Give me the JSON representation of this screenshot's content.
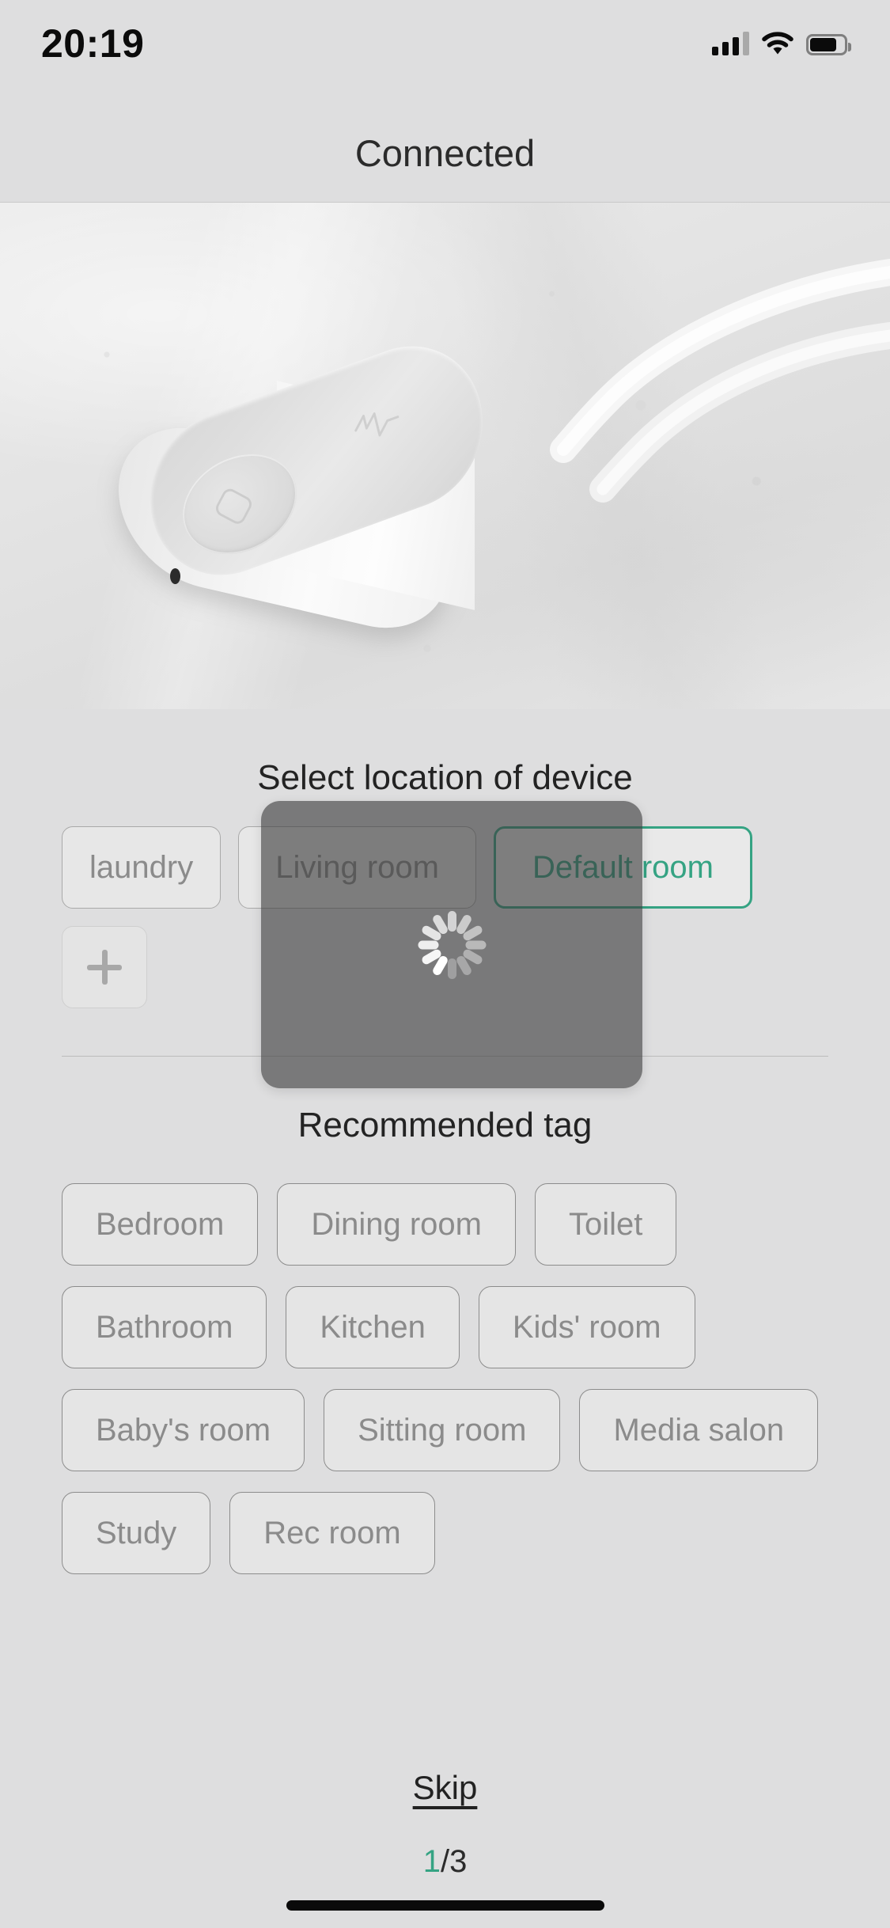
{
  "status_bar": {
    "time": "20:19",
    "cellular_icon": "cellular-signal-icon",
    "cellular_bars_filled": 3,
    "cellular_bars_total": 4,
    "wifi_icon": "wifi-icon",
    "battery_icon": "battery-icon",
    "battery_level_percent": 72
  },
  "nav": {
    "title": "Connected"
  },
  "hero": {
    "alt": "white smart relay device with two cables on a light textured wall"
  },
  "location_section": {
    "title": "Select location of device",
    "rooms": [
      {
        "label": "laundry",
        "selected": false
      },
      {
        "label": "Living room",
        "selected": false
      },
      {
        "label": "Default room",
        "selected": true
      }
    ],
    "add_room_icon": "plus-icon",
    "loading": true,
    "spinner_icon": "activity-spinner-icon"
  },
  "recommended_section": {
    "title": "Recommended tag",
    "tags": [
      "Bedroom",
      "Dining room",
      "Toilet",
      "Bathroom",
      "Kitchen",
      "Kids' room",
      "Baby's room",
      "Sitting room",
      "Media salon",
      "Study",
      "Rec room"
    ]
  },
  "footer": {
    "skip_label": "Skip",
    "page_current": "1",
    "page_separator": "/",
    "page_total": "3"
  },
  "colors": {
    "accent_green": "#35a383",
    "background": "#dededf",
    "chip_text": "#8b8b8b",
    "title_text": "#232323",
    "overlay": "rgba(60,60,60,0.62)"
  }
}
